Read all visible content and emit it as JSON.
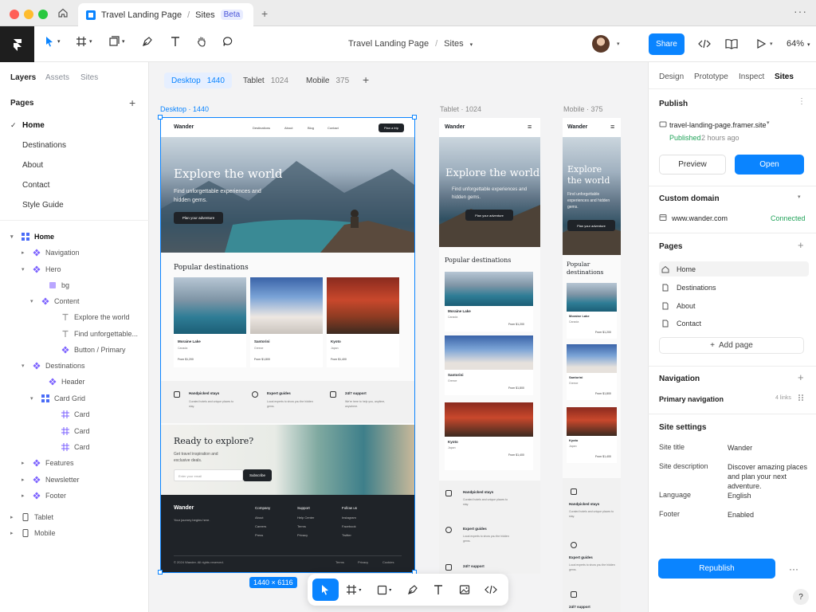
{
  "window": {
    "tab_title": "Travel Landing Page",
    "tab_section": "Sites",
    "tab_badge": "Beta"
  },
  "toolbar": {
    "project": "Travel Landing Page",
    "section": "Sites",
    "share": "Share",
    "zoom": "64%"
  },
  "left": {
    "tabs": [
      "Layers",
      "Assets",
      "Sites"
    ],
    "pages_title": "Pages",
    "pages": [
      "Home",
      "Destinations",
      "About",
      "Contact",
      "Style Guide"
    ],
    "layers": [
      "Home",
      "Navigation",
      "Hero",
      "bg",
      "Content",
      "Explore the world",
      "Find unforgettable...",
      "Button / Primary",
      "Destinations",
      "Header",
      "Card Grid",
      "Card",
      "Card",
      "Card",
      "Features",
      "Newsletter",
      "Footer",
      "Tablet",
      "Mobile"
    ]
  },
  "canvas": {
    "breakpoints": [
      {
        "name": "Desktop",
        "size": "1440"
      },
      {
        "name": "Tablet",
        "size": "1024"
      },
      {
        "name": "Mobile",
        "size": "375"
      }
    ],
    "label_desktop": "Desktop · 1440",
    "label_tablet": "Tablet · 1024",
    "label_mobile": "Mobile · 375",
    "size_badge": "1440 × 6116"
  },
  "site": {
    "brand": "Wander",
    "nav": [
      "Destinations",
      "About",
      "Blog",
      "Contact"
    ],
    "nav_cta": "Plan a trip",
    "hero_title": "Explore the world",
    "hero_sub": "Find unforgettable experiences and hidden gems.",
    "hero_cta": "Plan your adventure",
    "popular": "Popular destinations",
    "cards": [
      {
        "name": "Moraine Lake",
        "country": "Canada",
        "price": "From $1,200"
      },
      {
        "name": "Santorini",
        "country": "Greece",
        "price": "From $1,800"
      },
      {
        "name": "Kyoto",
        "country": "Japan",
        "price": "From $1,400"
      }
    ],
    "features": [
      {
        "title": "Handpicked stays",
        "text": "Curated hotels and unique places to stay."
      },
      {
        "title": "Expert guides",
        "text": "Local experts to show you the hidden gems."
      },
      {
        "title": "24/7 support",
        "text": "We're here to help you, anytime, anywhere."
      }
    ],
    "cta_title": "Ready to explore?",
    "cta_text": "Get travel inspiration and exclusive deals.",
    "email_placeholder": "Enter your email",
    "subscribe": "Subscribe",
    "footer_tag": "Your journey begins here.",
    "footer_cols": [
      {
        "title": "Company",
        "links": [
          "About",
          "Careers",
          "Press"
        ]
      },
      {
        "title": "Support",
        "links": [
          "Help Center",
          "Terms",
          "Privacy"
        ]
      },
      {
        "title": "Follow us",
        "links": [
          "Instagram",
          "Facebook",
          "Twitter"
        ]
      }
    ],
    "copyright": "© 2024 Wander. All rights reserved.",
    "footer_bottom": [
      "Terms",
      "Privacy",
      "Cookies"
    ]
  },
  "right": {
    "tabs": [
      "Design",
      "Prototype",
      "Inspect",
      "Sites"
    ],
    "publish": "Publish",
    "url": "travel-landing-page.framer.site",
    "published": "Published",
    "published_time": "2 hours ago",
    "preview": "Preview",
    "open": "Open",
    "custom_domain": "Custom domain",
    "domain": "www.wander.com",
    "connected": "Connected",
    "pages": "Pages",
    "page_list": [
      "Home",
      "Destinations",
      "About",
      "Contact"
    ],
    "add_page": "Add page",
    "navigation": "Navigation",
    "primary_nav": "Primary navigation",
    "links": "4 links",
    "site_settings": "Site settings",
    "settings": [
      {
        "k": "Site title",
        "v": "Wander"
      },
      {
        "k": "Site description",
        "v": "Discover amazing places and plan your next adventure."
      },
      {
        "k": "Language",
        "v": "English"
      },
      {
        "k": "Footer",
        "v": "Enabled"
      }
    ],
    "republish": "Republish",
    "help": "?"
  },
  "colors": {
    "accent": "#0a84ff",
    "green": "#22a35a",
    "dark": "#1f2328",
    "selection": "#0a84ff"
  }
}
